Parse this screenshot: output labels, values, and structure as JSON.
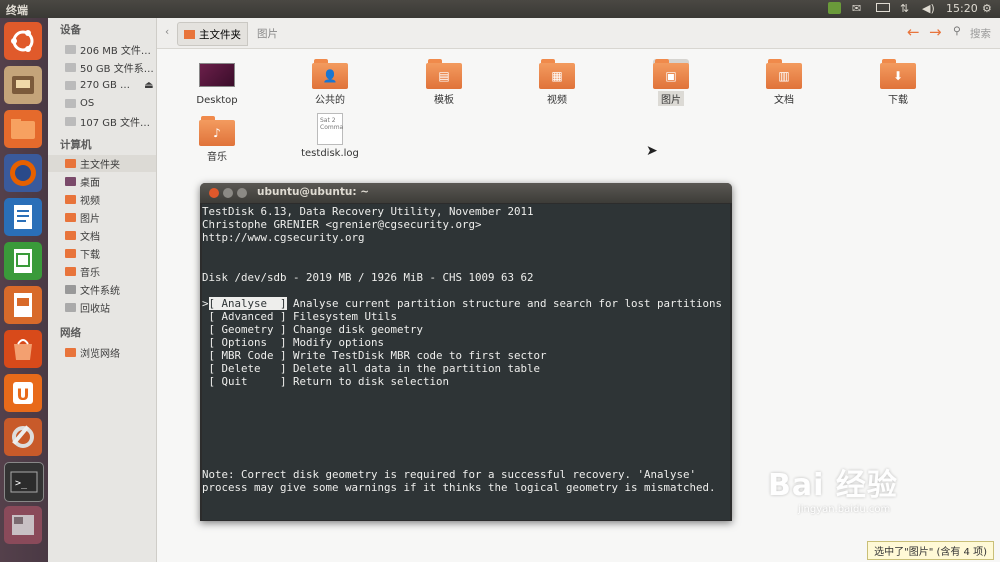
{
  "topbar": {
    "app_title": "终端",
    "time": "15:20"
  },
  "sidebar": {
    "devices_heading": "设备",
    "devices": [
      {
        "label": "206 MB 文件…"
      },
      {
        "label": "50 GB 文件系…"
      },
      {
        "label": "270 GB …"
      },
      {
        "label": "OS"
      },
      {
        "label": "107 GB 文件…"
      }
    ],
    "computer_heading": "计算机",
    "places": [
      {
        "label": "主文件夹",
        "icon": "home-icon"
      },
      {
        "label": "桌面",
        "icon": "desktop-icon"
      },
      {
        "label": "视频",
        "icon": "video-icon"
      },
      {
        "label": "图片",
        "icon": "picture-icon"
      },
      {
        "label": "文档",
        "icon": "document-icon"
      },
      {
        "label": "下载",
        "icon": "download-icon"
      },
      {
        "label": "音乐",
        "icon": "music-icon"
      },
      {
        "label": "文件系统",
        "icon": "filesystem-icon"
      },
      {
        "label": "回收站",
        "icon": "trash-icon"
      }
    ],
    "network_heading": "网络",
    "network": [
      {
        "label": "浏览网络"
      }
    ]
  },
  "pathbar": {
    "home": "主文件夹",
    "current": "图片",
    "search": "搜索"
  },
  "files": [
    {
      "label": "Desktop"
    },
    {
      "label": "公共的"
    },
    {
      "label": "模板"
    },
    {
      "label": "视频"
    },
    {
      "label": "图片"
    },
    {
      "label": "文档"
    },
    {
      "label": "下载"
    },
    {
      "label": "音乐"
    },
    {
      "label": "testdisk.log",
      "thumb": "Sat 2\nComma"
    }
  ],
  "terminal": {
    "title": "ubuntu@ubuntu: ~",
    "header": [
      "TestDisk 6.13, Data Recovery Utility, November 2011",
      "Christophe GRENIER <grenier@cgsecurity.org>",
      "http://www.cgsecurity.org"
    ],
    "disk": "Disk /dev/sdb - 2019 MB / 1926 MiB - CHS 1009 63 62",
    "menu": [
      {
        "prefix": ">",
        "key": "[ Analyse  ]",
        "desc": " Analyse current partition structure and search for lost partitions",
        "selected": true
      },
      {
        "prefix": " ",
        "key": "[ Advanced ]",
        "desc": " Filesystem Utils",
        "selected": false
      },
      {
        "prefix": " ",
        "key": "[ Geometry ]",
        "desc": " Change disk geometry",
        "selected": false
      },
      {
        "prefix": " ",
        "key": "[ Options  ]",
        "desc": " Modify options",
        "selected": false
      },
      {
        "prefix": " ",
        "key": "[ MBR Code ]",
        "desc": " Write TestDisk MBR code to first sector",
        "selected": false
      },
      {
        "prefix": " ",
        "key": "[ Delete   ]",
        "desc": " Delete all data in the partition table",
        "selected": false
      },
      {
        "prefix": " ",
        "key": "[ Quit     ]",
        "desc": " Return to disk selection",
        "selected": false
      }
    ],
    "note": [
      "Note: Correct disk geometry is required for a successful recovery. 'Analyse'",
      "process may give some warnings if it thinks the logical geometry is mismatched."
    ]
  },
  "statusbar": "选中了\"图片\" (含有 4 项)",
  "watermark": {
    "logo": "Bai 经验",
    "url": "jingyan.baidu.com"
  },
  "colors": {
    "accent": "#e95420",
    "folder": "#ef8a49",
    "terminal_bg": "#2e3436"
  }
}
